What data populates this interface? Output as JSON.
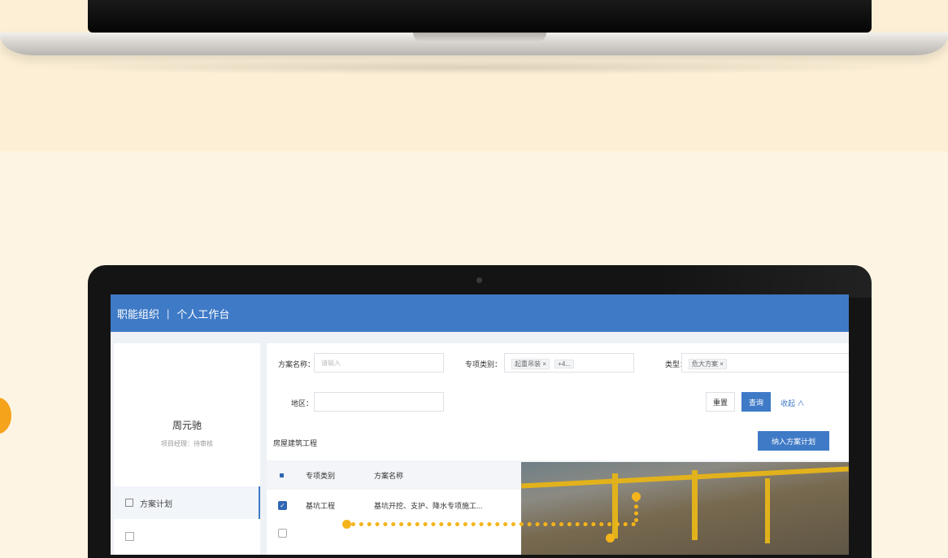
{
  "colors": {
    "background": "#fdf4e3",
    "accent_orange": "#f5a31b",
    "header_blue": "#3f7ac7"
  },
  "app": {
    "brand": "职能组织",
    "separator": "|",
    "title": "个人工作台"
  },
  "sidebar": {
    "user_name": "周元驰",
    "user_sub": "项目经理：待审核",
    "items": [
      {
        "label": "方案计划",
        "icon": "document-icon"
      }
    ]
  },
  "filters": {
    "scheme_name_label": "方案名称：",
    "scheme_name_placeholder": "请输入",
    "special_type_label": "专项类别：",
    "special_type_tags": [
      "起重吊装 ×",
      "+4..."
    ],
    "type_label": "类型：",
    "type_tags": [
      "危大方案 ×"
    ],
    "region_label": "地区："
  },
  "buttons": {
    "reset": "重置",
    "query": "查询",
    "collapse": "收起 ∧",
    "add_plan": "纳入方案计划"
  },
  "section_title": "房屋建筑工程",
  "table": {
    "headers": [
      "专项类别",
      "方案名称"
    ],
    "rows": [
      {
        "category": "基坑工程",
        "name": "基坑开挖、支护、降水专项施工..."
      }
    ]
  }
}
